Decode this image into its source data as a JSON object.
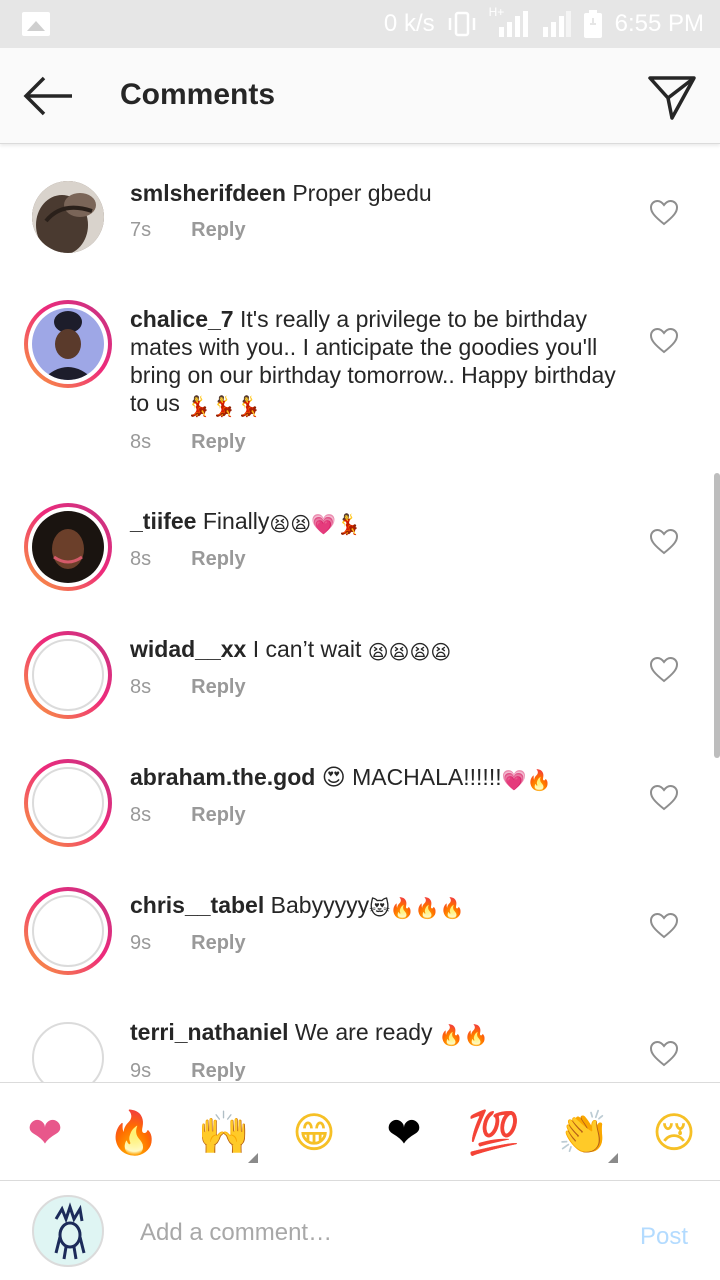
{
  "status_bar": {
    "speed": "0 k/s",
    "network": "H+",
    "time": "6:55 PM",
    "icons": [
      "image-icon",
      "vibrate-icon",
      "signal-icon",
      "signal-icon",
      "battery-icon"
    ]
  },
  "header": {
    "title": "Comments",
    "back_icon": "arrow-left-icon",
    "share_icon": "paper-plane-icon"
  },
  "comments": [
    {
      "username": "smlsherifdeen",
      "text": "Proper gbedu",
      "emojis": "",
      "time": "7s",
      "reply": "Reply"
    },
    {
      "username": "chalice_7",
      "text": "It's really a privilege to be birthday mates with you.. I anticipate the goodies you'll bring on our birthday tomorrow.. Happy birthday to us",
      "emojis": "💃💃💃",
      "time": "8s",
      "reply": "Reply"
    },
    {
      "username": "_tiifee",
      "text": "Finally",
      "emojis": "😫😫💗💃",
      "time": "8s",
      "reply": "Reply"
    },
    {
      "username": "widad__xx",
      "text": "I can’t wait",
      "emojis": "😫😫😫😫",
      "time": "8s",
      "reply": "Reply"
    },
    {
      "username": "abraham.the.god",
      "text": "😍 MACHALA!!!!!!",
      "emojis": "💗🔥",
      "time": "8s",
      "reply": "Reply"
    },
    {
      "username": "chris__tabel",
      "text": "Babyyyyy",
      "emojis": "😻🔥🔥🔥",
      "time": "9s",
      "reply": "Reply"
    },
    {
      "username": "terri_nathaniel",
      "text": "We are ready",
      "emojis": "🔥🔥",
      "time": "9s",
      "reply": "Reply"
    }
  ],
  "emoji_bar": [
    "❤",
    "🔥",
    "🙌",
    "😁",
    "❤",
    "💯",
    "👏",
    "😢"
  ],
  "composer": {
    "placeholder": "Add a comment…",
    "post_label": "Post"
  },
  "colors": {
    "accent_blue_disabled": "#b3dbff",
    "story_ring_start": "#f9a23a",
    "story_ring_end": "#c13584",
    "meta_gray": "#999999",
    "heart_pink": "#e8578b"
  }
}
